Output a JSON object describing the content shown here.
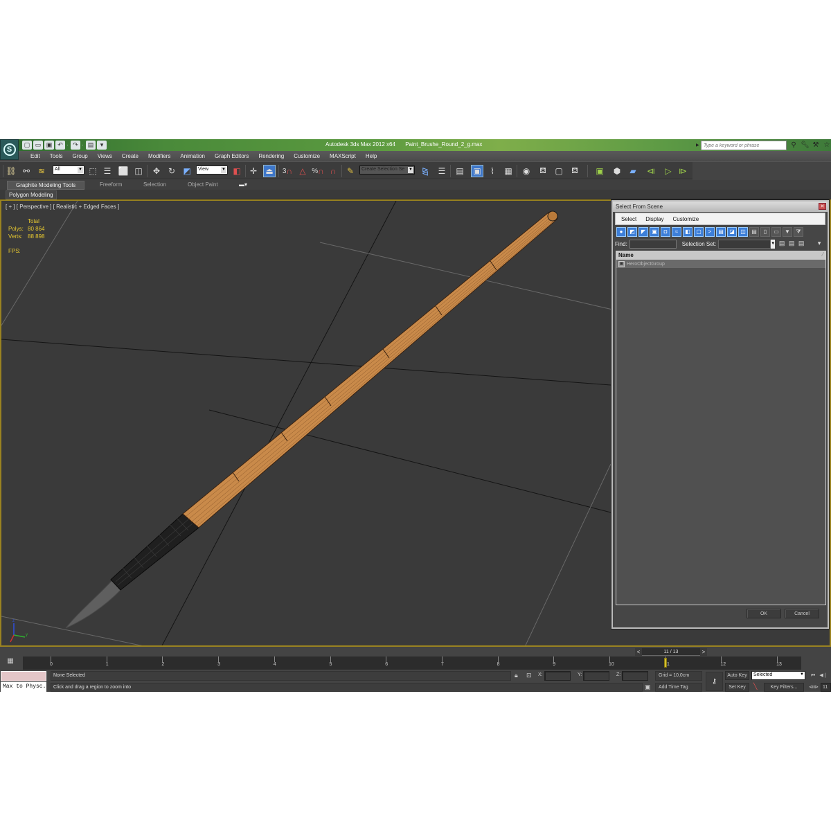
{
  "titlebar": {
    "app_title": "Autodesk 3ds Max  2012 x64",
    "file_name": "Paint_Brushe_Round_2_g.max",
    "search_placeholder": "Type a keyword or phrase",
    "logo_glyph": "S",
    "quick_access_icons": [
      "new-file-icon",
      "open-file-icon",
      "save-icon",
      "undo-icon",
      "redo-icon",
      "project-folder-icon"
    ],
    "right_icons": [
      "binoculars-icon",
      "wrench-icon",
      "satellite-icon",
      "star-icon"
    ]
  },
  "menubar": {
    "items": [
      "Edit",
      "Tools",
      "Group",
      "Views",
      "Create",
      "Modifiers",
      "Animation",
      "Graph Editors",
      "Rendering",
      "Customize",
      "MAXScript",
      "Help"
    ]
  },
  "toolbar": {
    "selection_filter": "All",
    "reference_coord": "View",
    "named_selection_placeholder": "Create Selection Se",
    "snap_labels": {
      "snap": "3",
      "percent": "%"
    }
  },
  "ribbon": {
    "tabs": [
      "Graphite Modeling Tools",
      "Freeform",
      "Selection",
      "Object Paint"
    ],
    "active_tab": "Graphite Modeling Tools",
    "panel": "Polygon Modeling"
  },
  "viewport": {
    "label": "[ + ] [ Perspective ] [ Realistic + Edged Faces ]",
    "stats": {
      "header": "Total",
      "polys_label": "Polys:",
      "polys_value": "80 864",
      "verts_label": "Verts:",
      "verts_value": "88 898",
      "fps_label": "FPS:"
    },
    "axis_labels": {
      "x": "x",
      "y": "y",
      "z": "z"
    },
    "colors": {
      "handle": "#c98a4a",
      "ferrule": "#1e1e1e",
      "bristle": "#5a5a5a",
      "frame": "#9a8320"
    }
  },
  "dialog": {
    "title": "Select From Scene",
    "menu": [
      "Select",
      "Display",
      "Customize"
    ],
    "find_label": "Find:",
    "find_value": "",
    "selection_set_label": "Selection Set:",
    "selection_set_value": "",
    "column_header": "Name",
    "rows": [
      {
        "name": "HeroObjectGroup",
        "icon": "group-icon"
      }
    ],
    "ok_label": "OK",
    "cancel_label": "Cancel",
    "filter_icons": [
      "geometry-icon",
      "shapes-icon",
      "lights-icon",
      "cameras-icon",
      "helpers-icon",
      "spacewarps-icon",
      "groups-icon",
      "xrefs-icon",
      "bones-icon",
      "containers-icon",
      "frozen-icon",
      "hidden-icon"
    ]
  },
  "timeline": {
    "frame_display": "11 / 13",
    "prev": "<",
    "next": ">",
    "ticks": [
      "0",
      "1",
      "2",
      "3",
      "4",
      "5",
      "6",
      "7",
      "8",
      "9",
      "10",
      "11",
      "12",
      "13"
    ],
    "current_frame": 11,
    "total_frames": 13
  },
  "status": {
    "listener_text": "Max to Physc.",
    "selection_status": "None Selected",
    "prompt": "Click and drag a region to zoom into",
    "x_label": "X:",
    "y_label": "Y:",
    "z_label": "Z:",
    "x_value": "",
    "y_value": "",
    "z_value": "",
    "grid": "Grid = 10,0cm",
    "add_time_tag": "Add Time Tag",
    "auto_key": "Auto Key",
    "set_key": "Set Key",
    "key_mode": "Selected",
    "key_filters": "Key Filters...",
    "frame_field": "11"
  }
}
